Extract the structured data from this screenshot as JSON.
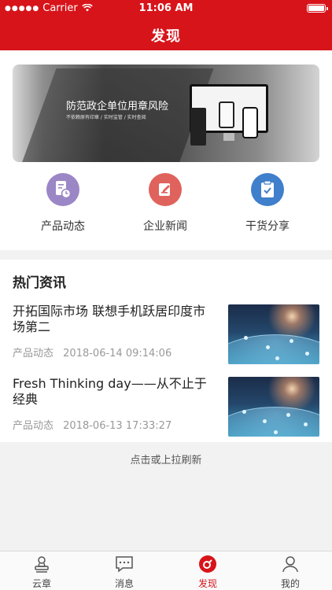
{
  "status_bar": {
    "carrier": "Carrier",
    "time": "11:06 AM"
  },
  "header": {
    "title": "发现"
  },
  "banner": {
    "title": "防范政企单位用章风险",
    "subtitle": "不依赖原有印章 / 实时监管 / 实时查阅"
  },
  "quick_links": [
    {
      "label": "产品动态",
      "icon": "document-clock-icon",
      "color": "#9b86c6"
    },
    {
      "label": "企业新闻",
      "icon": "edit-note-icon",
      "color": "#e0625c"
    },
    {
      "label": "干货分享",
      "icon": "clipboard-check-icon",
      "color": "#3f7fcb"
    }
  ],
  "hot_news": {
    "title": "热门资讯",
    "items": [
      {
        "title": "开拓国际市场 联想手机跃居印度市场第二",
        "category": "产品动态",
        "date": "2018-06-14 09:14:06"
      },
      {
        "title": "Fresh Thinking day——从不止于经典",
        "category": "产品动态",
        "date": "2018-06-13 17:33:27"
      }
    ]
  },
  "refresh_hint": "点击或上拉刷新",
  "tabbar": [
    {
      "label": "云章",
      "icon": "seal-icon"
    },
    {
      "label": "消息",
      "icon": "message-icon"
    },
    {
      "label": "发现",
      "icon": "discover-icon",
      "active": true
    },
    {
      "label": "我的",
      "icon": "profile-icon"
    }
  ],
  "colors": {
    "primary": "#d7141a"
  }
}
